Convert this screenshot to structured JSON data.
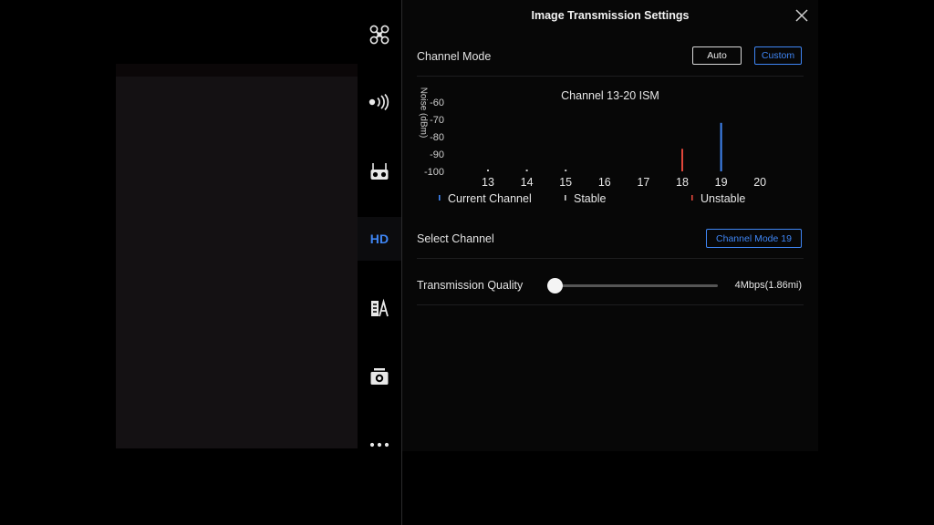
{
  "panel": {
    "title": "Image Transmission Settings"
  },
  "nav": {
    "items": [
      {
        "icon": "drone-icon",
        "active": false
      },
      {
        "icon": "signal-icon",
        "active": false
      },
      {
        "icon": "remote-controller-icon",
        "active": false
      },
      {
        "icon": "hd-icon",
        "label": "HD",
        "active": true
      },
      {
        "icon": "battery-icon",
        "active": false
      },
      {
        "icon": "camera-icon",
        "active": false
      },
      {
        "icon": "more-icon",
        "active": false
      }
    ]
  },
  "channel_mode": {
    "label": "Channel Mode",
    "auto_label": "Auto",
    "custom_label": "Custom",
    "selected": "Custom"
  },
  "select_channel": {
    "label": "Select Channel",
    "button_label": "Channel Mode 19"
  },
  "transmission_quality": {
    "label": "Transmission Quality",
    "value_text": "4Mbps(1.86mi)",
    "level": 0.0
  },
  "colors": {
    "accent": "#3f86f5",
    "unstable": "#e0463a",
    "stable": "#cfcfcf"
  },
  "chart_data": {
    "type": "bar",
    "title": "Channel 13-20 ISM",
    "ylabel": "Noise (dBm)",
    "xlabel": "",
    "categories": [
      "13",
      "14",
      "15",
      "16",
      "17",
      "18",
      "19",
      "20"
    ],
    "ylim": [
      -100,
      -60
    ],
    "yticks": [
      "-60",
      "-70",
      "-80",
      "-90",
      "-100"
    ],
    "bars": [
      {
        "x": "13",
        "value": -99,
        "status": "stable"
      },
      {
        "x": "14",
        "value": -99,
        "status": "stable"
      },
      {
        "x": "15",
        "value": -99,
        "status": "stable"
      },
      {
        "x": "18",
        "value": -87,
        "status": "unstable"
      },
      {
        "x": "19",
        "value": -72,
        "status": "current"
      }
    ],
    "legend": [
      {
        "label": "Current Channel",
        "status": "current"
      },
      {
        "label": "Stable",
        "status": "stable"
      },
      {
        "label": "Unstable",
        "status": "unstable"
      }
    ]
  }
}
